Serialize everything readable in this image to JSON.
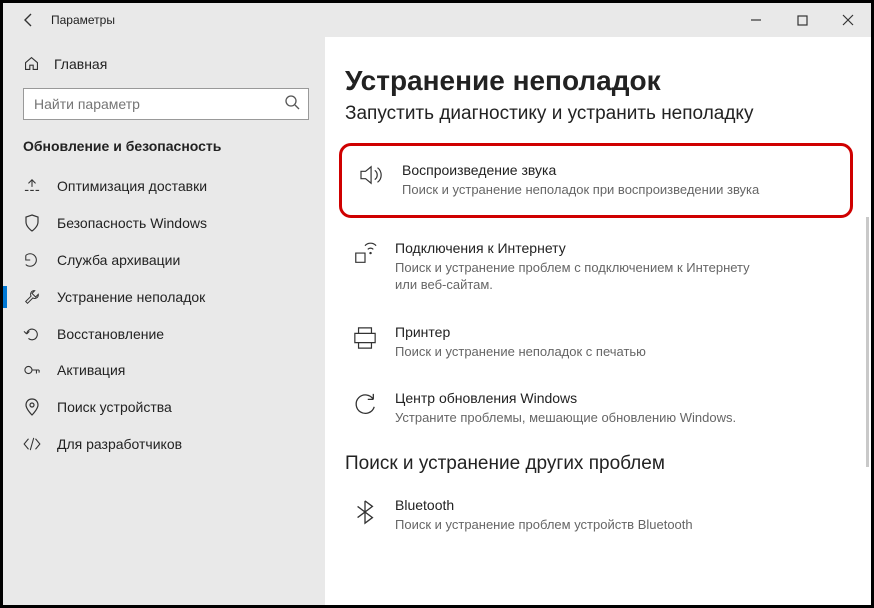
{
  "window": {
    "title": "Параметры"
  },
  "sidebar": {
    "home": "Главная",
    "search_placeholder": "Найти параметр",
    "section": "Обновление и безопасность",
    "items": [
      {
        "label": "Оптимизация доставки"
      },
      {
        "label": "Безопасность Windows"
      },
      {
        "label": "Служба архивации"
      },
      {
        "label": "Устранение неполадок"
      },
      {
        "label": "Восстановление"
      },
      {
        "label": "Активация"
      },
      {
        "label": "Поиск устройства"
      },
      {
        "label": "Для разработчиков"
      }
    ]
  },
  "main": {
    "heading": "Устранение неполадок",
    "subheading": "Запустить диагностику и устранить неполадку",
    "troubleshooters": [
      {
        "title": "Воспроизведение звука",
        "desc": "Поиск и устранение неполадок при воспроизведении звука"
      },
      {
        "title": "Подключения к Интернету",
        "desc": "Поиск и устранение проблем с подключением к Интернету или веб-сайтам."
      },
      {
        "title": "Принтер",
        "desc": "Поиск и устранение неполадок с печатью"
      },
      {
        "title": "Центр обновления Windows",
        "desc": "Устраните проблемы, мешающие обновлению Windows."
      }
    ],
    "section2": "Поиск и устранение других проблем",
    "other": [
      {
        "title": "Bluetooth",
        "desc": "Поиск и устранение проблем устройств Bluetooth"
      }
    ]
  }
}
